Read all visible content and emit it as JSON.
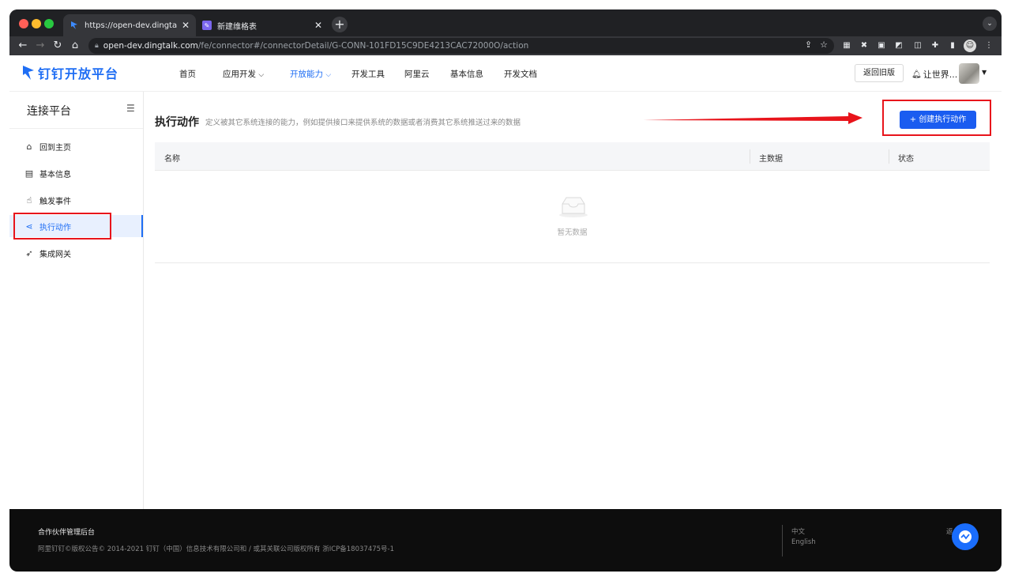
{
  "browser": {
    "tabs": [
      {
        "title": "https://open-dev.dingtalk.com/"
      },
      {
        "title": "新建维格表"
      }
    ],
    "url_host": "open-dev.dingtalk.com",
    "url_path": "/fe/connector#/connectorDetail/G-CONN-101FD15C9DE4213CAC72000O/action"
  },
  "header": {
    "logo_text": "钉钉开放平台",
    "nav": [
      "首页",
      "应用开发",
      "开放能力",
      "开发工具",
      "阿里云",
      "基本信息",
      "开发文档"
    ],
    "old_version_button": "返回旧版",
    "user_name": "让世界..."
  },
  "sidebar": {
    "title": "连接平台",
    "items": [
      {
        "label": "回到主页",
        "icon": "home-icon"
      },
      {
        "label": "基本信息",
        "icon": "document-icon"
      },
      {
        "label": "触发事件",
        "icon": "touch-icon"
      },
      {
        "label": "执行动作",
        "icon": "share-icon"
      },
      {
        "label": "集成网关",
        "icon": "rocket-icon"
      }
    ]
  },
  "main": {
    "title": "执行动作",
    "description": "定义被其它系统连接的能力，例如提供接口来提供系统的数据或者消费其它系统推送过来的数据",
    "create_button": "+  创建执行动作",
    "columns": [
      "名称",
      "主数据",
      "状态"
    ],
    "empty_text": "暂无数据"
  },
  "footer": {
    "title": "合作伙伴管理后台",
    "copyright": "阿里钉钉©版权公告© 2014-2021 钉钉（中国）信息技术有限公司和 / 或其关联公司版权所有 浙ICP备18037475号-1",
    "lang_zh": "中文",
    "lang_en": "English",
    "back": "返"
  },
  "colors": {
    "accent": "#1f6ef4",
    "button": "#1a5cf0",
    "annotation_red": "#e8141b"
  }
}
